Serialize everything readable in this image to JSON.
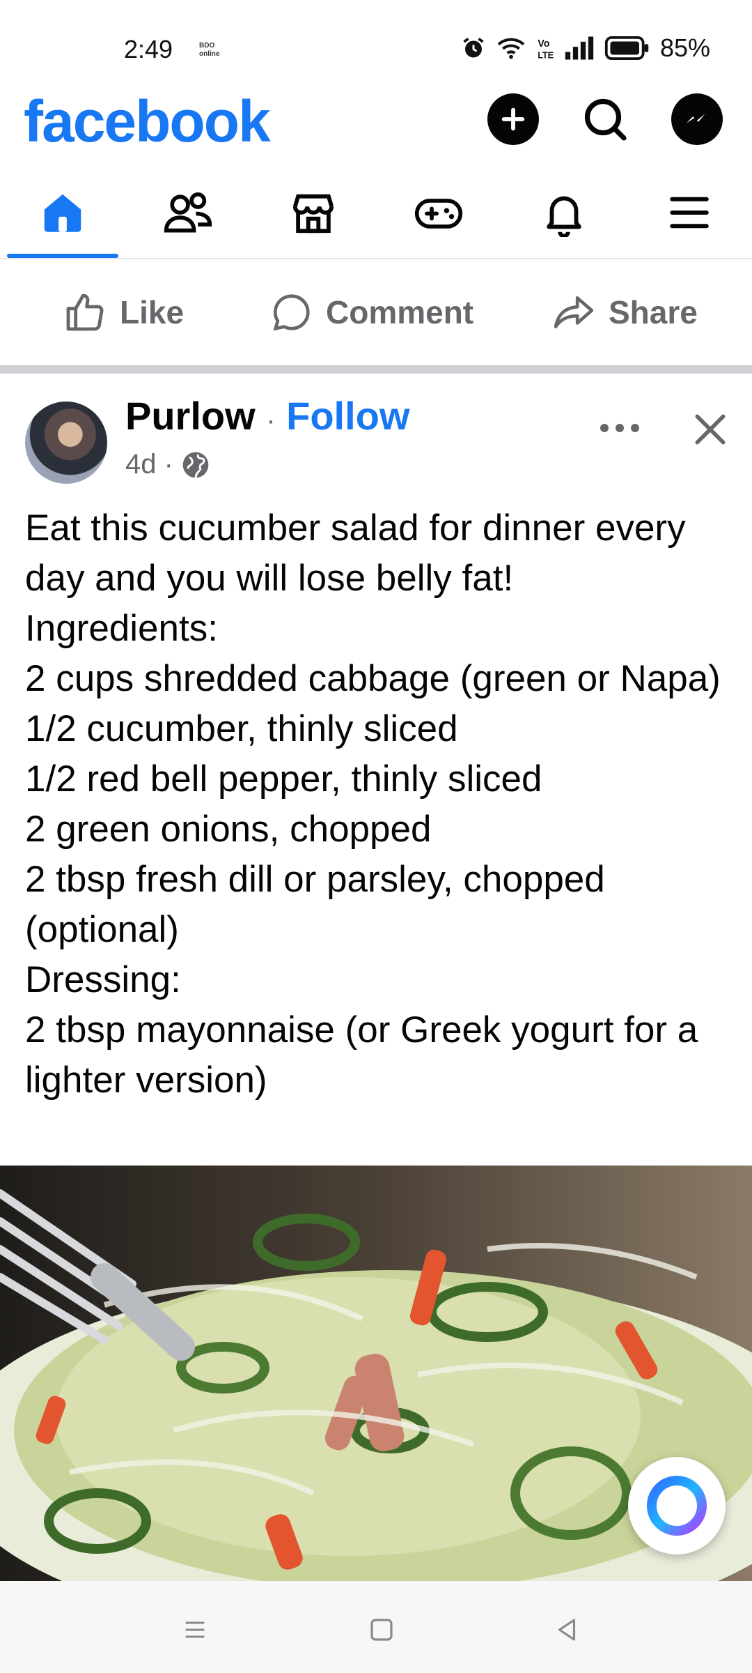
{
  "status_bar": {
    "time": "2:49",
    "carrier_badge": "BDO online",
    "battery_percent": "85%",
    "icons": [
      "alarm-icon",
      "wifi-icon",
      "volte-icon",
      "signal-icon",
      "battery-icon"
    ]
  },
  "header": {
    "logo": "facebook",
    "icons": [
      "create-icon",
      "search-icon",
      "messenger-icon"
    ]
  },
  "tabs": [
    {
      "name": "home",
      "icon": "home-icon",
      "active": true
    },
    {
      "name": "friends",
      "icon": "friends-icon",
      "active": false
    },
    {
      "name": "marketplace",
      "icon": "marketplace-icon",
      "active": false
    },
    {
      "name": "gaming",
      "icon": "gaming-icon",
      "active": false
    },
    {
      "name": "notifications",
      "icon": "bell-icon",
      "active": false
    },
    {
      "name": "menu",
      "icon": "hamburger-icon",
      "active": false
    }
  ],
  "actions": {
    "like": "Like",
    "comment": "Comment",
    "share": "Share"
  },
  "post": {
    "author": "Purlow",
    "separator": "·",
    "follow": "Follow",
    "time": "4d ·",
    "privacy_icon": "globe-icon",
    "text": "Eat this cucumber salad for dinner every day and you will lose belly fat!\nIngredients:\n2 cups shredded cabbage (green or Napa)\n1/2 cucumber, thinly sliced\n1/2 red bell pepper, thinly sliced\n2 green onions, chopped\n2 tbsp fresh dill or parsley, chopped (optional)\nDressing:\n2 tbsp mayonnaise (or Greek yogurt for a lighter version)",
    "image_icon": "salad-photo"
  },
  "colors": {
    "brand": "#1877f2",
    "muted": "#65676b",
    "divider": "#ced0d4"
  },
  "navbar": {
    "icons": [
      "recents-icon",
      "home-button-icon",
      "back-icon"
    ]
  }
}
